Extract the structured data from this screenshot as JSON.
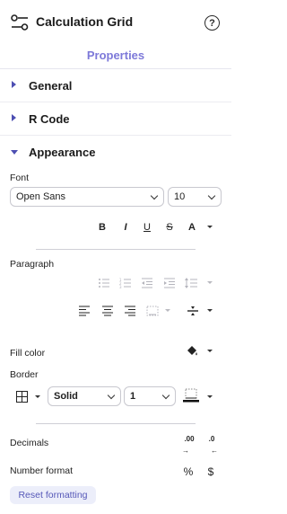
{
  "header": {
    "title": "Calculation Grid",
    "app_icon": "sliders-icon",
    "help_icon": "help-circle-icon",
    "help_glyph": "?"
  },
  "tabs": {
    "active": "Properties"
  },
  "sections": [
    {
      "label": "General",
      "expanded": false
    },
    {
      "label": "R Code",
      "expanded": false
    },
    {
      "label": "Appearance",
      "expanded": true
    }
  ],
  "font": {
    "label": "Font",
    "family": "Open Sans",
    "size": "10",
    "style_buttons": {
      "bold": "B",
      "italic": "I",
      "underline": "U",
      "strike": "S",
      "color": "A"
    }
  },
  "paragraph": {
    "label": "Paragraph"
  },
  "fill": {
    "label": "Fill color",
    "icon": "paint-bucket-icon"
  },
  "border": {
    "label": "Border",
    "style": "Solid",
    "width": "1",
    "icon": "border-grid-icon"
  },
  "decimals": {
    "label": "Decimals",
    "increase": ".00",
    "decrease": ".0"
  },
  "number_format": {
    "label": "Number format",
    "percent": "%",
    "currency": "$"
  },
  "reset_label": "Reset formatting",
  "colors": {
    "accent": "#7d79d9",
    "caret": "#4d4fb2",
    "reset_bg": "#eceefa",
    "reset_text": "#5658b8"
  }
}
